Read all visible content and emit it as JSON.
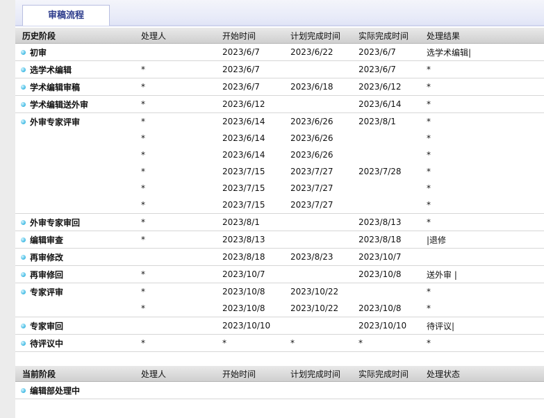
{
  "tab": {
    "label": "审稿流程"
  },
  "history": {
    "headers": [
      "历史阶段",
      "处理人",
      "开始时间",
      "计划完成时间",
      "实际完成时间",
      "处理结果"
    ],
    "rows": [
      {
        "stage": "初审",
        "handler": "",
        "start": "2023/6/7",
        "plan": "2023/6/22",
        "actual": "2023/6/7",
        "result": "选学术编辑|"
      },
      {
        "stage": "选学术编辑",
        "handler": "*",
        "start": "2023/6/7",
        "plan": "",
        "actual": "2023/6/7",
        "result": "*"
      },
      {
        "stage": "学术编辑审稿",
        "handler": "*",
        "start": "2023/6/7",
        "plan": "2023/6/18",
        "actual": "2023/6/12",
        "result": "*"
      },
      {
        "stage": "学术编辑送外审",
        "handler": "*",
        "start": "2023/6/12",
        "plan": "",
        "actual": "2023/6/14",
        "result": "*"
      },
      {
        "stage": "外审专家评审",
        "handler": "*",
        "start": "2023/6/14",
        "plan": "2023/6/26",
        "actual": "2023/8/1",
        "result": "*"
      },
      {
        "stage": "",
        "handler": "*",
        "start": "2023/6/14",
        "plan": "2023/6/26",
        "actual": "",
        "result": "*"
      },
      {
        "stage": "",
        "handler": "*",
        "start": "2023/6/14",
        "plan": "2023/6/26",
        "actual": "",
        "result": "*"
      },
      {
        "stage": "",
        "handler": "*",
        "start": "2023/7/15",
        "plan": "2023/7/27",
        "actual": "2023/7/28",
        "result": "*"
      },
      {
        "stage": "",
        "handler": "*",
        "start": "2023/7/15",
        "plan": "2023/7/27",
        "actual": "",
        "result": "*"
      },
      {
        "stage": "",
        "handler": "*",
        "start": "2023/7/15",
        "plan": "2023/7/27",
        "actual": "",
        "result": "*"
      },
      {
        "stage": "外审专家审回",
        "handler": "*",
        "start": "2023/8/1",
        "plan": "",
        "actual": "2023/8/13",
        "result": "*"
      },
      {
        "stage": "编辑审查",
        "handler": "*",
        "start": "2023/8/13",
        "plan": "",
        "actual": "2023/8/18",
        "result": "|退修"
      },
      {
        "stage": "再审修改",
        "handler": "",
        "start": "2023/8/18",
        "plan": "2023/8/23",
        "actual": "2023/10/7",
        "result": ""
      },
      {
        "stage": "再审修回",
        "handler": "*",
        "start": "2023/10/7",
        "plan": "",
        "actual": "2023/10/8",
        "result": "送外审 |"
      },
      {
        "stage": "专家评审",
        "handler": "*",
        "start": "2023/10/8",
        "plan": "2023/10/22",
        "actual": "",
        "result": "*"
      },
      {
        "stage": "",
        "handler": "*",
        "start": "2023/10/8",
        "plan": "2023/10/22",
        "actual": "2023/10/8",
        "result": "*"
      },
      {
        "stage": "专家审回",
        "handler": "",
        "start": "2023/10/10",
        "plan": "",
        "actual": "2023/10/10",
        "result": "待评议|"
      },
      {
        "stage": "待评议中",
        "handler": "*",
        "start": "*",
        "plan": "*",
        "actual": "*",
        "result": "*"
      }
    ]
  },
  "current": {
    "headers": [
      "当前阶段",
      "处理人",
      "开始时间",
      "计划完成时间",
      "实际完成时间",
      "处理状态"
    ],
    "rows": [
      {
        "stage": "编辑部处理中",
        "handler": "",
        "start": "",
        "plan": "",
        "actual": "",
        "result": ""
      }
    ]
  },
  "colors": {
    "tab_text": "#2d3c8c",
    "bullet": "#3fb9e3",
    "header_bg": "#d9d9d9"
  }
}
